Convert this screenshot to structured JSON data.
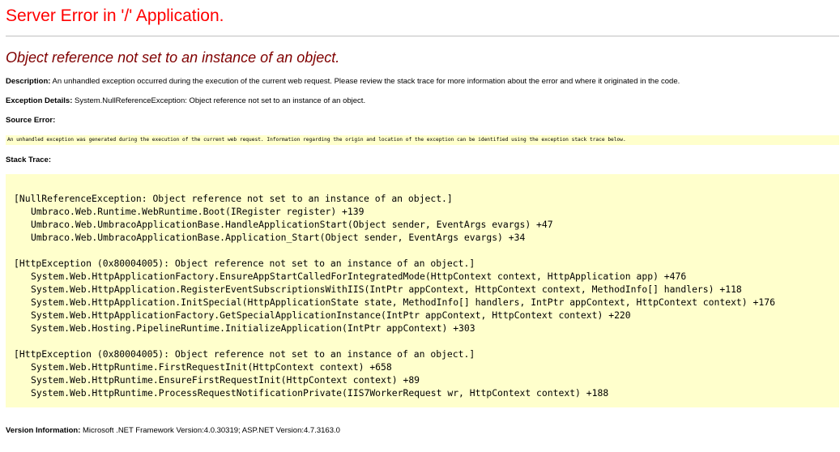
{
  "page": {
    "title": "Server Error in '/' Application.",
    "error_message": "Object reference not set to an instance of an object."
  },
  "description": {
    "label": "Description:",
    "text": " An unhandled exception occurred during the execution of the current web request. Please review the stack trace for more information about the error and where it originated in the code."
  },
  "exception_details": {
    "label": "Exception Details:",
    "text": " System.NullReferenceException: Object reference not set to an instance of an object."
  },
  "source_error": {
    "label": "Source Error:",
    "text": "An unhandled exception was generated during the execution of the current web request. Information regarding the origin and location of the exception can be identified using the exception stack trace below."
  },
  "stack_trace": {
    "label": "Stack Trace:",
    "blocks": [
      {
        "header": "[NullReferenceException: Object reference not set to an instance of an object.]",
        "frames": [
          "Umbraco.Web.Runtime.WebRuntime.Boot(IRegister register) +139",
          "Umbraco.Web.UmbracoApplicationBase.HandleApplicationStart(Object sender, EventArgs evargs) +47",
          "Umbraco.Web.UmbracoApplicationBase.Application_Start(Object sender, EventArgs evargs) +34"
        ]
      },
      {
        "header": "[HttpException (0x80004005): Object reference not set to an instance of an object.]",
        "frames": [
          "System.Web.HttpApplicationFactory.EnsureAppStartCalledForIntegratedMode(HttpContext context, HttpApplication app) +476",
          "System.Web.HttpApplication.RegisterEventSubscriptionsWithIIS(IntPtr appContext, HttpContext context, MethodInfo[] handlers) +118",
          "System.Web.HttpApplication.InitSpecial(HttpApplicationState state, MethodInfo[] handlers, IntPtr appContext, HttpContext context) +176",
          "System.Web.HttpApplicationFactory.GetSpecialApplicationInstance(IntPtr appContext, HttpContext context) +220",
          "System.Web.Hosting.PipelineRuntime.InitializeApplication(IntPtr appContext) +303"
        ]
      },
      {
        "header": "[HttpException (0x80004005): Object reference not set to an instance of an object.]",
        "frames": [
          "System.Web.HttpRuntime.FirstRequestInit(HttpContext context) +658",
          "System.Web.HttpRuntime.EnsureFirstRequestInit(HttpContext context) +89",
          "System.Web.HttpRuntime.ProcessRequestNotificationPrivate(IIS7WorkerRequest wr, HttpContext context) +188"
        ]
      }
    ]
  },
  "version_information": {
    "label": "Version Information:",
    "text": " Microsoft .NET Framework Version:4.0.30319; ASP.NET Version:4.7.3163.0"
  },
  "colors": {
    "title": "#ff0000",
    "error_message": "#800000",
    "box_background": "#ffffcc",
    "rule": "#c0c0c0"
  }
}
